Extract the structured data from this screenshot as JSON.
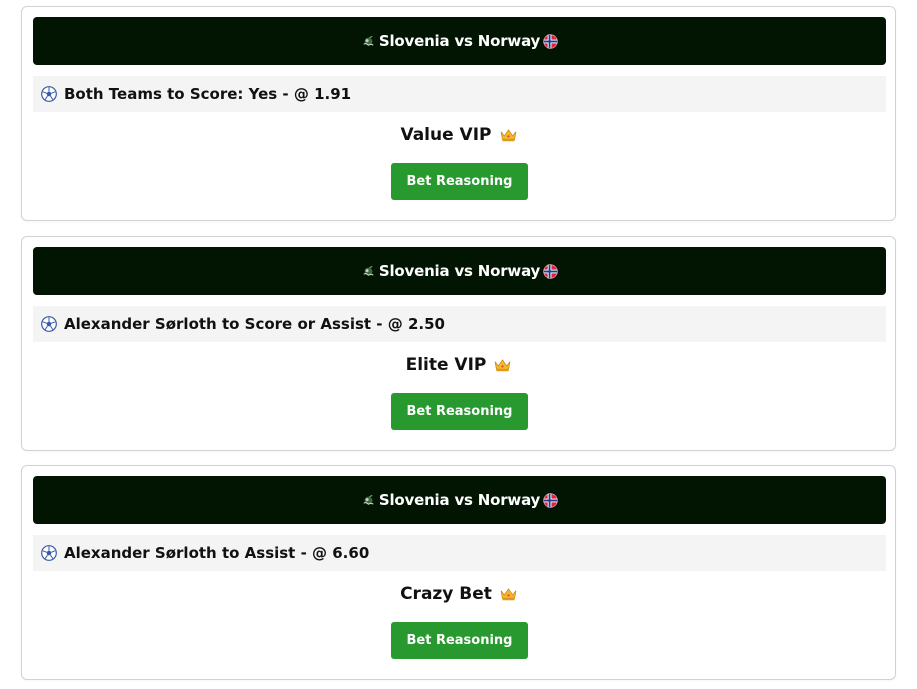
{
  "colors": {
    "header_bg": "#021502",
    "bet_row_bg": "#f4f4f4",
    "button_bg": "#27992f",
    "card_border": "#d2d2d2"
  },
  "icons": {
    "left_team": "slovenia-badge-icon",
    "right_team": "norway-flag-icon",
    "bet": "soccer-ball-icon",
    "tier": "crown-icon"
  },
  "cards": [
    {
      "match": "Slovenia vs Norway",
      "bet": "Both Teams to Score: Yes - @ 1.91",
      "tier": "Value VIP",
      "button_label": "Bet Reasoning"
    },
    {
      "match": "Slovenia vs Norway",
      "bet": "Alexander Sørloth to Score or Assist - @ 2.50",
      "tier": "Elite VIP",
      "button_label": "Bet Reasoning"
    },
    {
      "match": "Slovenia vs Norway",
      "bet": "Alexander Sørloth to Assist - @ 6.60",
      "tier": "Crazy Bet",
      "button_label": "Bet Reasoning"
    }
  ]
}
